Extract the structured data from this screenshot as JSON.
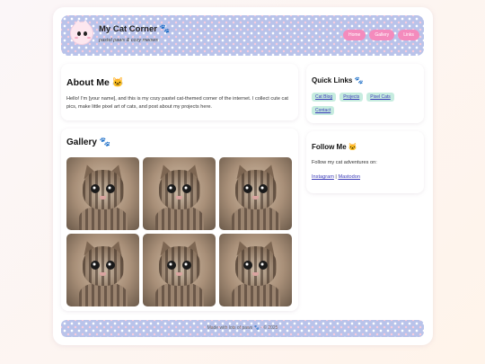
{
  "header": {
    "title": "My Cat Corner 🐾",
    "subtitle": "pastel paws & cozy meows",
    "nav": [
      "Home",
      "Gallery",
      "Links"
    ]
  },
  "about": {
    "heading": "About Me 🐱",
    "text": "Hello! I'm [your name], and this is my cozy pastel cat-themed corner of the internet. I collect cute cat pics, make little pixel art of cats, and post about my projects here."
  },
  "gallery": {
    "heading": "Gallery 🐾",
    "images": [
      "kitten",
      "kitten",
      "kitten",
      "kitten",
      "kitten",
      "kitten"
    ]
  },
  "quick_links": {
    "heading": "Quick Links 🐾",
    "items": [
      "Cat Blog",
      "Projects",
      "Pixel Cats",
      "Contact"
    ]
  },
  "follow": {
    "heading": "Follow Me 🐱",
    "text": "Follow my cat adventures on:",
    "link1": "Instagram",
    "sep": " | ",
    "link2": "Mastodon"
  },
  "footer": {
    "text": "Made with lots of paws 🐾 · © 2025"
  },
  "colors": {
    "header_pattern": "#b9c3ea",
    "nav_button": "#f48bbd",
    "link_chip": "#c6ecdf",
    "link_text": "#3a3ab8"
  }
}
